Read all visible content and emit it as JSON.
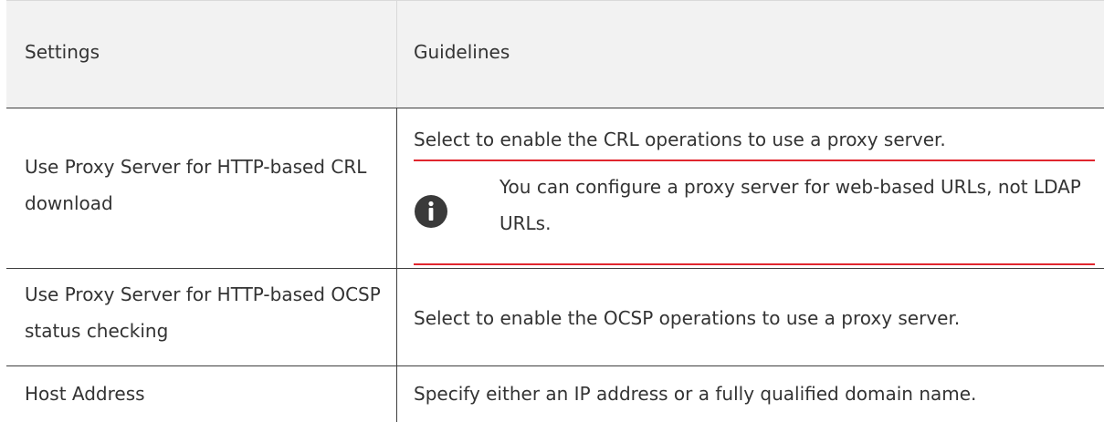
{
  "table": {
    "headers": {
      "settings": "Settings",
      "guidelines": "Guidelines"
    },
    "rows": [
      {
        "setting": "Use Proxy Server for HTTP-based CRL download",
        "guideline": "Select to enable the CRL operations to use a proxy server.",
        "note": "You can configure a proxy server for web-based URLs, not LDAP URLs."
      },
      {
        "setting": "Use Proxy Server for HTTP-based OCSP status checking",
        "guideline": "Select to enable the OCSP operations to use a proxy server."
      },
      {
        "setting": "Host Address",
        "guideline": "Specify either an IP address or a fully qualified domain name."
      }
    ]
  },
  "colors": {
    "header_bg": "#f2f2f2",
    "note_rule": "#e0262e",
    "info_icon": "#3a3a3a"
  },
  "icons": {
    "note": "info-icon"
  }
}
